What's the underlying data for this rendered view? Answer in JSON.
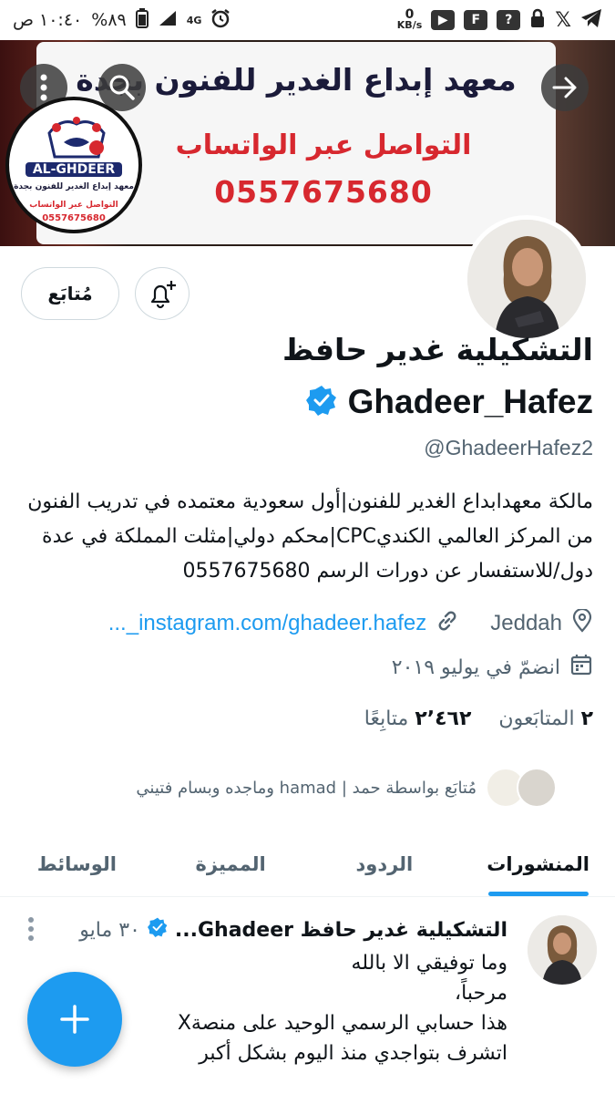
{
  "status_bar": {
    "time": "١٠:٤٠ ص",
    "battery": "٨٩%",
    "network": "4G",
    "speed_value": "0",
    "speed_unit": "KB/s"
  },
  "banner": {
    "line1": "معهد إبداع الغدير للفنون بجدة",
    "line2": "التواصل عبر الواتساب",
    "line3": "0557675680",
    "logo_latin": "AL-GHDEER",
    "logo_line1": "معهد إبداع الغدير للفنون بجدة",
    "logo_line2": "التواصل عبر الواتساب",
    "logo_line3": "0557675680"
  },
  "actions": {
    "follow_label": "مُتابَع"
  },
  "profile": {
    "name_ar": "التشكيلية غدير حافظ",
    "name_en": "Ghadeer_Hafez",
    "handle": "@GhadeerHafez2",
    "bio": "مالكة معهدابداع الغدير للفنون|أول سعودية معتمده في تدريب الفنون من المركز العالمي الكنديCPC|محكم دولي|مثلت المملكة في عدة دول/للاستفسار عن دورات الرسم 0557675680",
    "location": "Jeddah",
    "link": "instagram.com/ghadeer.hafez_...",
    "joined": "انضمّ في يوليو ٢٠١٩"
  },
  "stats": {
    "followers_count": "٢",
    "followers_label": "المتابَعون",
    "following_count": "٢٬٤٦٢",
    "following_label": "متابِعًا"
  },
  "followed_by": {
    "text": "مُتابَع بواسطة حمد | hamad وماجده وبسام فتيني"
  },
  "tabs": [
    {
      "label": "المنشورات"
    },
    {
      "label": "الردود"
    },
    {
      "label": "المميزة"
    },
    {
      "label": "الوسائط"
    }
  ],
  "post": {
    "author": "التشكيلية غدير حافظ Ghadeer...",
    "date": "٣٠ مايو",
    "line1": "وما توفيقي الا بالله",
    "line2": "مرحباً،",
    "line3": "هذا حسابي الرسمي الوحيد على منصةX",
    "line4": "اتشرف بتواجدي منذ اليوم بشكل أكبر"
  },
  "colors": {
    "accent": "#1d9bf0",
    "banner_red": "#d7282f",
    "banner_navy": "#1b1b3a"
  }
}
